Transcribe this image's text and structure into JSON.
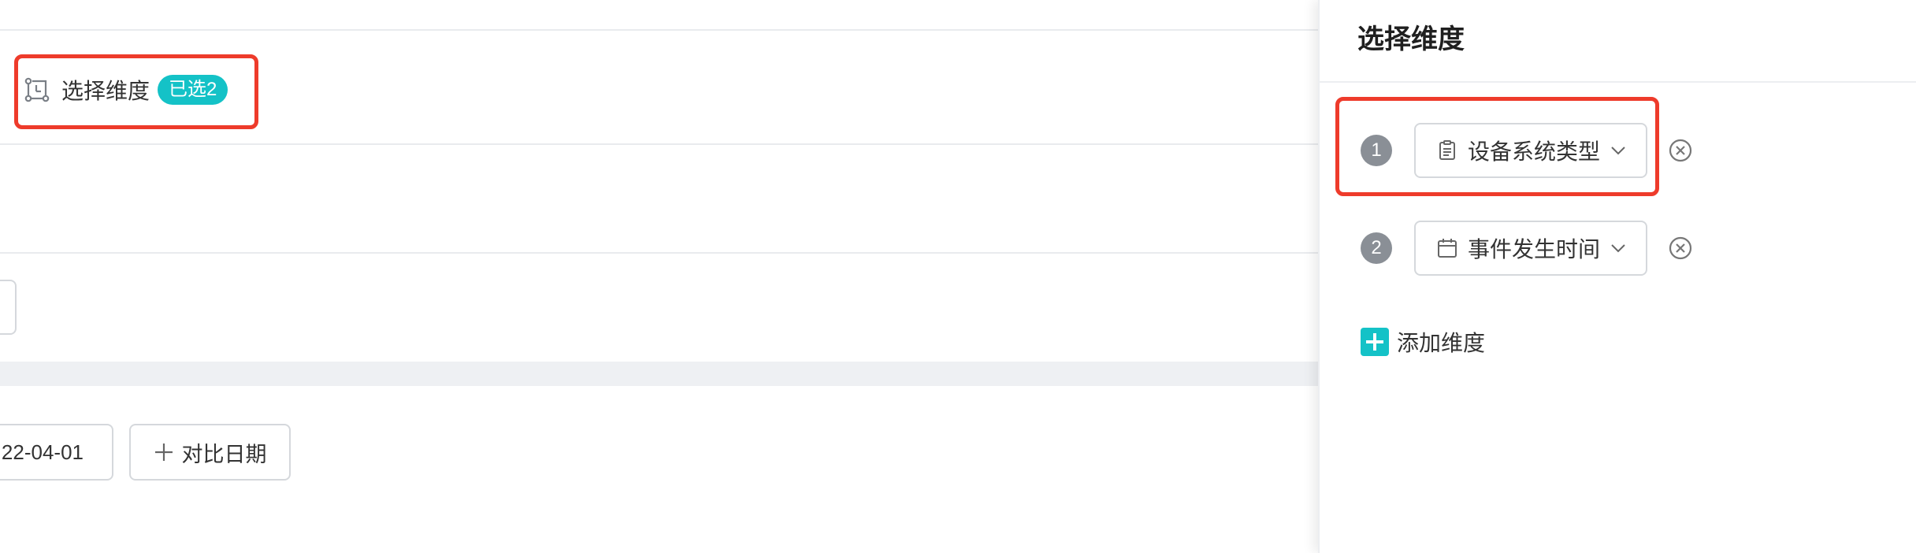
{
  "toolbar": {
    "dimension_selector": {
      "label": "选择维度",
      "badge": "已选2",
      "icon": "dimension-icon"
    }
  },
  "date_range": {
    "end_date_partial": "22-04-01"
  },
  "compare_button": {
    "label": "对比日期",
    "icon": "plus-icon"
  },
  "panel": {
    "title": "选择维度",
    "dimensions": [
      {
        "index": "1",
        "label": "设备系统类型",
        "icon": "clipboard-icon"
      },
      {
        "index": "2",
        "label": "事件发生时间",
        "icon": "calendar-icon"
      }
    ],
    "add_label": "添加维度"
  },
  "colors": {
    "accent": "#14c2c7",
    "highlight_box": "#ee3b2b",
    "index_badge": "#8a8f96"
  }
}
